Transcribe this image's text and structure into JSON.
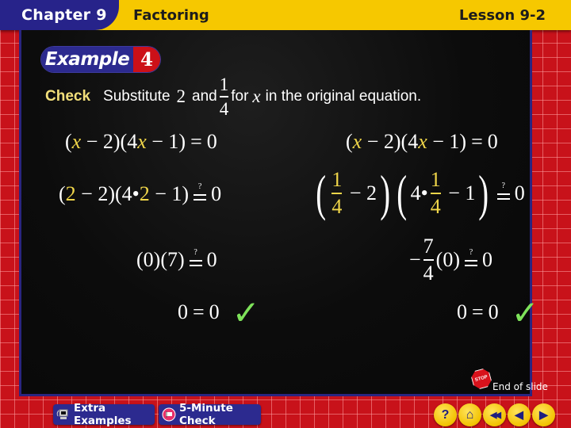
{
  "header": {
    "chapter": "Chapter 9",
    "section": "Factoring",
    "lesson": "Lesson 9-2"
  },
  "example_badge": {
    "word": "Example",
    "number": "4"
  },
  "instruction": {
    "label": "Check",
    "text_before": "Substitute",
    "value1": "2",
    "and": "and",
    "frac_num": "1",
    "frac_den": "4",
    "for": "for",
    "variable": "x",
    "text_after": "in the original equation."
  },
  "left_column": {
    "line1": {
      "open": "(",
      "var": "x",
      "mid": " − 2)(4",
      "var2": "x",
      "end": " − 1)",
      "eq": "=",
      "rhs": "0"
    },
    "line2": {
      "p1": "(",
      "sub": "2",
      "p2": " − 2)(4•",
      "sub2": "2",
      "p3": " − 1)",
      "q": "?",
      "rhs": "0"
    },
    "line3": {
      "lhs": "(0)(7)",
      "q": "?",
      "rhs": "0"
    },
    "line4": {
      "lhs": "0",
      "eq": "=",
      "rhs": "0",
      "check": "✓"
    }
  },
  "right_column": {
    "line1": {
      "open": "(",
      "var": "x",
      "mid": " − 2)(4",
      "var2": "x",
      "end": " − 1)",
      "eq": "=",
      "rhs": "0"
    },
    "line2": {
      "num": "1",
      "den": "4",
      "minus2": " − 2",
      "four": "4•",
      "minus1": " − 1",
      "q": "?",
      "rhs": "0"
    },
    "line3": {
      "sign": "−",
      "num": "7",
      "den": "4",
      "lhs": "(0)",
      "q": "?",
      "rhs": "0"
    },
    "line4": {
      "lhs": "0",
      "eq": "=",
      "rhs": "0",
      "check": "✓"
    }
  },
  "end_of_slide": {
    "stop": "STOP",
    "label": "End of slide"
  },
  "bottom_bar": {
    "extra_examples": "Extra Examples",
    "five_minute_check": "5-Minute Check",
    "nav": [
      {
        "icon": "help-icon",
        "glyph": "?"
      },
      {
        "icon": "home-icon",
        "glyph": "⌂"
      },
      {
        "icon": "first-slide-icon",
        "glyph": "◀◀"
      },
      {
        "icon": "previous-icon",
        "glyph": "◀"
      },
      {
        "icon": "next-icon",
        "glyph": "▶"
      }
    ]
  },
  "colors": {
    "header_yellow": "#f6c800",
    "chapter_blue": "#27238a",
    "frame_red": "#c8121a",
    "highlight_yellow": "#f0d64a",
    "check_green": "#7ee35a"
  }
}
